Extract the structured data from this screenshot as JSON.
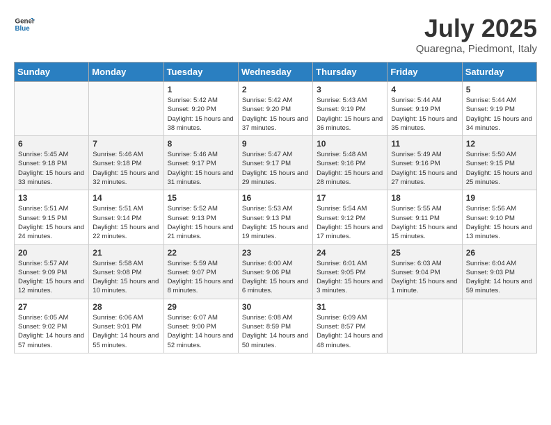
{
  "header": {
    "logo_text_general": "General",
    "logo_text_blue": "Blue",
    "month_title": "July 2025",
    "location": "Quaregna, Piedmont, Italy"
  },
  "days_of_week": [
    "Sunday",
    "Monday",
    "Tuesday",
    "Wednesday",
    "Thursday",
    "Friday",
    "Saturday"
  ],
  "weeks": [
    [
      {
        "day": "",
        "empty": true
      },
      {
        "day": "",
        "empty": true
      },
      {
        "day": "1",
        "sunrise": "Sunrise: 5:42 AM",
        "sunset": "Sunset: 9:20 PM",
        "daylight": "Daylight: 15 hours and 38 minutes."
      },
      {
        "day": "2",
        "sunrise": "Sunrise: 5:42 AM",
        "sunset": "Sunset: 9:20 PM",
        "daylight": "Daylight: 15 hours and 37 minutes."
      },
      {
        "day": "3",
        "sunrise": "Sunrise: 5:43 AM",
        "sunset": "Sunset: 9:19 PM",
        "daylight": "Daylight: 15 hours and 36 minutes."
      },
      {
        "day": "4",
        "sunrise": "Sunrise: 5:44 AM",
        "sunset": "Sunset: 9:19 PM",
        "daylight": "Daylight: 15 hours and 35 minutes."
      },
      {
        "day": "5",
        "sunrise": "Sunrise: 5:44 AM",
        "sunset": "Sunset: 9:19 PM",
        "daylight": "Daylight: 15 hours and 34 minutes."
      }
    ],
    [
      {
        "day": "6",
        "sunrise": "Sunrise: 5:45 AM",
        "sunset": "Sunset: 9:18 PM",
        "daylight": "Daylight: 15 hours and 33 minutes."
      },
      {
        "day": "7",
        "sunrise": "Sunrise: 5:46 AM",
        "sunset": "Sunset: 9:18 PM",
        "daylight": "Daylight: 15 hours and 32 minutes."
      },
      {
        "day": "8",
        "sunrise": "Sunrise: 5:46 AM",
        "sunset": "Sunset: 9:17 PM",
        "daylight": "Daylight: 15 hours and 31 minutes."
      },
      {
        "day": "9",
        "sunrise": "Sunrise: 5:47 AM",
        "sunset": "Sunset: 9:17 PM",
        "daylight": "Daylight: 15 hours and 29 minutes."
      },
      {
        "day": "10",
        "sunrise": "Sunrise: 5:48 AM",
        "sunset": "Sunset: 9:16 PM",
        "daylight": "Daylight: 15 hours and 28 minutes."
      },
      {
        "day": "11",
        "sunrise": "Sunrise: 5:49 AM",
        "sunset": "Sunset: 9:16 PM",
        "daylight": "Daylight: 15 hours and 27 minutes."
      },
      {
        "day": "12",
        "sunrise": "Sunrise: 5:50 AM",
        "sunset": "Sunset: 9:15 PM",
        "daylight": "Daylight: 15 hours and 25 minutes."
      }
    ],
    [
      {
        "day": "13",
        "sunrise": "Sunrise: 5:51 AM",
        "sunset": "Sunset: 9:15 PM",
        "daylight": "Daylight: 15 hours and 24 minutes."
      },
      {
        "day": "14",
        "sunrise": "Sunrise: 5:51 AM",
        "sunset": "Sunset: 9:14 PM",
        "daylight": "Daylight: 15 hours and 22 minutes."
      },
      {
        "day": "15",
        "sunrise": "Sunrise: 5:52 AM",
        "sunset": "Sunset: 9:13 PM",
        "daylight": "Daylight: 15 hours and 21 minutes."
      },
      {
        "day": "16",
        "sunrise": "Sunrise: 5:53 AM",
        "sunset": "Sunset: 9:13 PM",
        "daylight": "Daylight: 15 hours and 19 minutes."
      },
      {
        "day": "17",
        "sunrise": "Sunrise: 5:54 AM",
        "sunset": "Sunset: 9:12 PM",
        "daylight": "Daylight: 15 hours and 17 minutes."
      },
      {
        "day": "18",
        "sunrise": "Sunrise: 5:55 AM",
        "sunset": "Sunset: 9:11 PM",
        "daylight": "Daylight: 15 hours and 15 minutes."
      },
      {
        "day": "19",
        "sunrise": "Sunrise: 5:56 AM",
        "sunset": "Sunset: 9:10 PM",
        "daylight": "Daylight: 15 hours and 13 minutes."
      }
    ],
    [
      {
        "day": "20",
        "sunrise": "Sunrise: 5:57 AM",
        "sunset": "Sunset: 9:09 PM",
        "daylight": "Daylight: 15 hours and 12 minutes."
      },
      {
        "day": "21",
        "sunrise": "Sunrise: 5:58 AM",
        "sunset": "Sunset: 9:08 PM",
        "daylight": "Daylight: 15 hours and 10 minutes."
      },
      {
        "day": "22",
        "sunrise": "Sunrise: 5:59 AM",
        "sunset": "Sunset: 9:07 PM",
        "daylight": "Daylight: 15 hours and 8 minutes."
      },
      {
        "day": "23",
        "sunrise": "Sunrise: 6:00 AM",
        "sunset": "Sunset: 9:06 PM",
        "daylight": "Daylight: 15 hours and 6 minutes."
      },
      {
        "day": "24",
        "sunrise": "Sunrise: 6:01 AM",
        "sunset": "Sunset: 9:05 PM",
        "daylight": "Daylight: 15 hours and 3 minutes."
      },
      {
        "day": "25",
        "sunrise": "Sunrise: 6:03 AM",
        "sunset": "Sunset: 9:04 PM",
        "daylight": "Daylight: 15 hours and 1 minute."
      },
      {
        "day": "26",
        "sunrise": "Sunrise: 6:04 AM",
        "sunset": "Sunset: 9:03 PM",
        "daylight": "Daylight: 14 hours and 59 minutes."
      }
    ],
    [
      {
        "day": "27",
        "sunrise": "Sunrise: 6:05 AM",
        "sunset": "Sunset: 9:02 PM",
        "daylight": "Daylight: 14 hours and 57 minutes."
      },
      {
        "day": "28",
        "sunrise": "Sunrise: 6:06 AM",
        "sunset": "Sunset: 9:01 PM",
        "daylight": "Daylight: 14 hours and 55 minutes."
      },
      {
        "day": "29",
        "sunrise": "Sunrise: 6:07 AM",
        "sunset": "Sunset: 9:00 PM",
        "daylight": "Daylight: 14 hours and 52 minutes."
      },
      {
        "day": "30",
        "sunrise": "Sunrise: 6:08 AM",
        "sunset": "Sunset: 8:59 PM",
        "daylight": "Daylight: 14 hours and 50 minutes."
      },
      {
        "day": "31",
        "sunrise": "Sunrise: 6:09 AM",
        "sunset": "Sunset: 8:57 PM",
        "daylight": "Daylight: 14 hours and 48 minutes."
      },
      {
        "day": "",
        "empty": true
      },
      {
        "day": "",
        "empty": true
      }
    ]
  ]
}
